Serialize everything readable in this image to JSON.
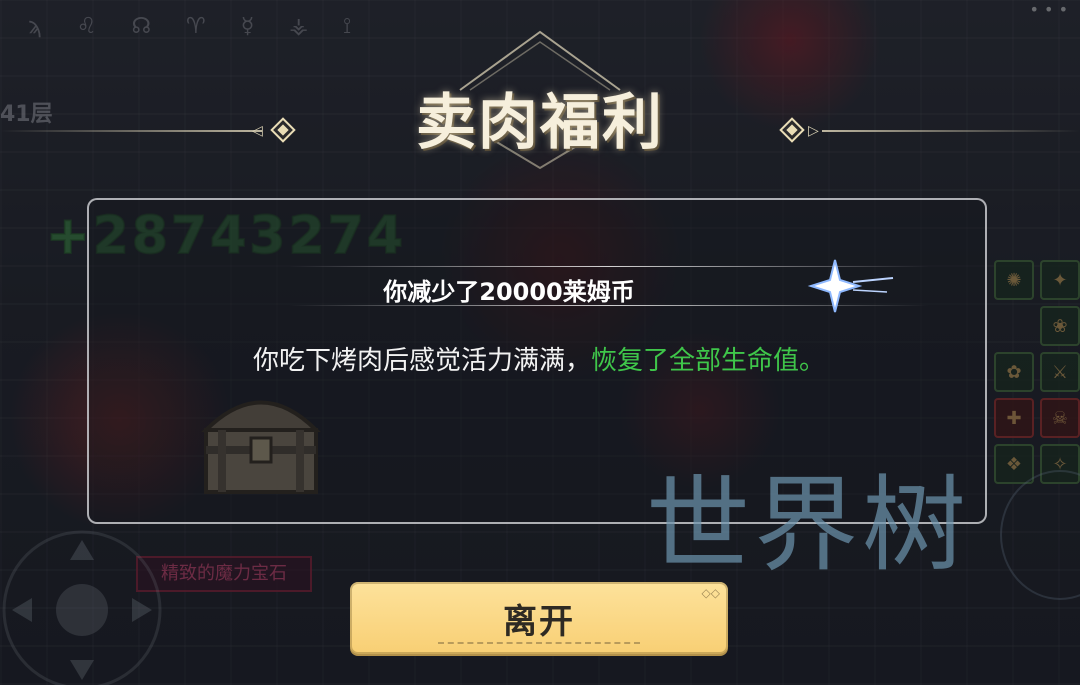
{
  "background": {
    "floor_label": "41层",
    "damage_number": "+28743274",
    "gem_label": "精致的魔力宝石",
    "runes": "ϡ ♌ ☊ ♈ ☿ ⚶ ⟟",
    "skill_slots": [
      "✺",
      "✦",
      "❂",
      "❀",
      "✿",
      "⚔",
      "✚",
      "☠",
      "❖",
      "✧"
    ]
  },
  "dialog": {
    "title": "卖肉福利",
    "message": "你减少了20000莱姆币",
    "effect_text_normal": "你吃下烤肉后感觉活力满满，",
    "effect_text_highlight": "恢复了全部生命值。",
    "leave_button_label": "离开"
  },
  "watermark": "世界树",
  "colors": {
    "highlight_green": "#3fc64a",
    "button_gold": "#f8cf74",
    "title_cream": "#f6efdc"
  }
}
